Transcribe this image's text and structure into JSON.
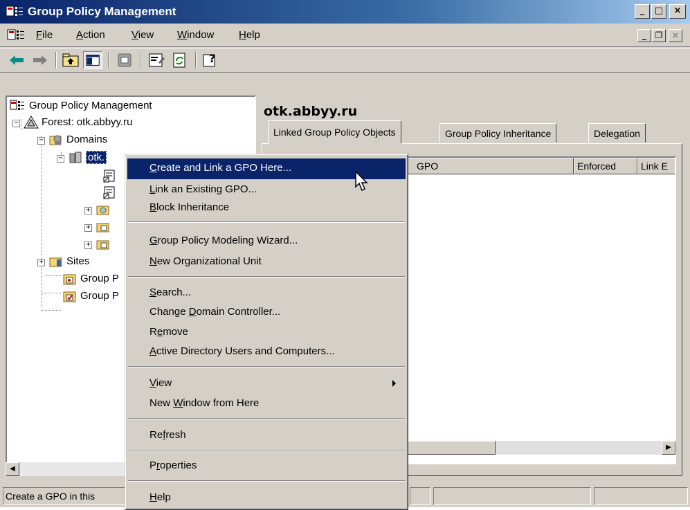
{
  "window": {
    "title": "Group Policy Management"
  },
  "menubar": {
    "items": [
      "File",
      "Action",
      "View",
      "Window",
      "Help"
    ]
  },
  "toolbar": {
    "icons": [
      "back-icon",
      "forward-icon",
      "up-folder-icon",
      "show-hide-tree-icon",
      "delete-icon",
      "properties-icon",
      "refresh-icon",
      "help-icon"
    ]
  },
  "tree": {
    "root": "Group Policy Management",
    "forest": "Forest: otk.abbyy.ru",
    "domains": "Domains",
    "selected_domain": "otk.",
    "sites": "Sites",
    "group_p_1": "Group P",
    "group_p_2": "Group P"
  },
  "right_pane": {
    "domain_title": "otk.abbyy.ru",
    "tabs": [
      "Linked Group Policy Objects",
      "Group Policy Inheritance",
      "Delegation"
    ],
    "active_tab": "Linked Group Policy Objects",
    "columns": [
      "GPO",
      "Enforced",
      "Link E"
    ]
  },
  "context_menu": {
    "items": [
      {
        "label": "Create and Link a GPO Here...",
        "highlighted": true
      },
      {
        "label": "Link an Existing GPO..."
      },
      {
        "label": "Block Inheritance"
      },
      {
        "label": "Group Policy Modeling Wizard..."
      },
      {
        "label": "New Organizational Unit"
      },
      {
        "label": "Search..."
      },
      {
        "label": "Change Domain Controller..."
      },
      {
        "label": "Remove"
      },
      {
        "label": "Active Directory Users and Computers..."
      },
      {
        "label": "View",
        "submenu": true
      },
      {
        "label": "New Window from Here"
      },
      {
        "label": "Refresh"
      },
      {
        "label": "Properties"
      },
      {
        "label": "Help"
      }
    ]
  },
  "statusbar": {
    "text": "Create a GPO in this"
  },
  "colors": {
    "titlebar_start": "#0a246a",
    "titlebar_end": "#a6caf0",
    "selection": "#0a246a",
    "chrome": "#d4d0c8"
  }
}
